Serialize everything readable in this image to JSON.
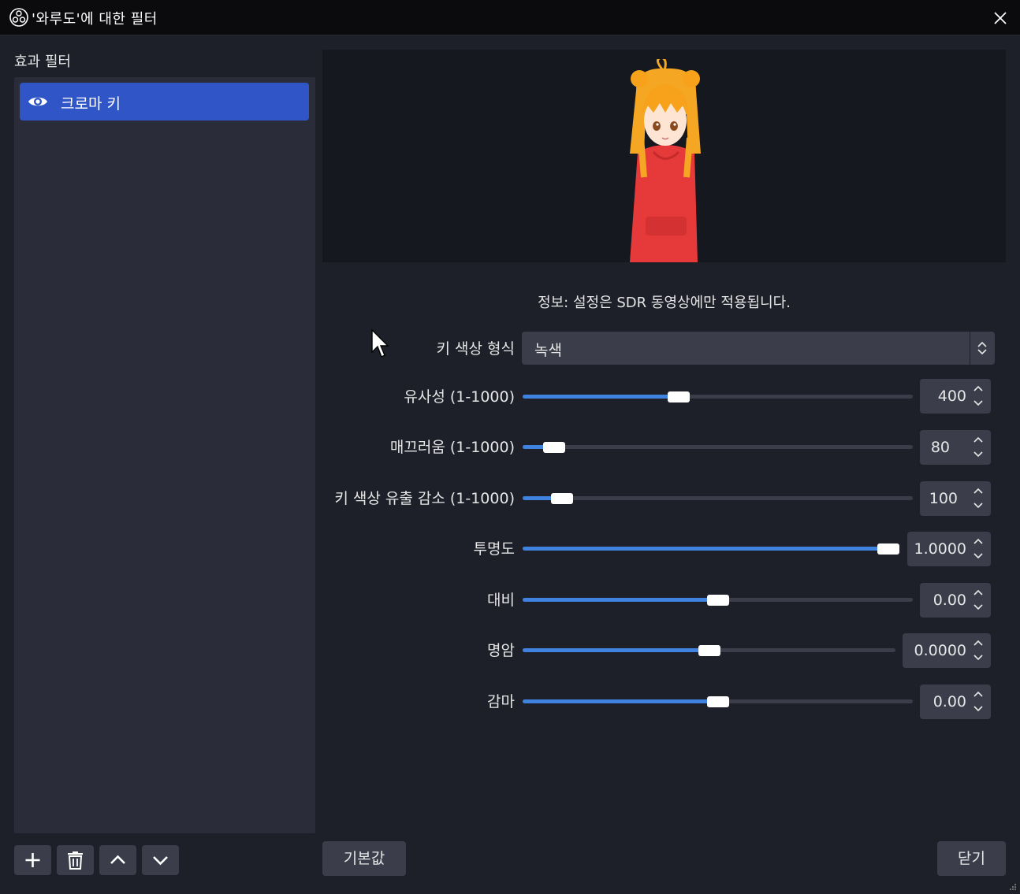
{
  "window": {
    "title": "'와루도'에 대한 필터",
    "app_icon": "obs-logo-icon",
    "close_icon": "close-icon"
  },
  "filters": {
    "section_label": "효과 필터",
    "items": [
      {
        "label": "크로마 키",
        "icon": "eye-icon",
        "selected": true
      }
    ],
    "toolbar": [
      "add-icon",
      "trash-icon",
      "chevron-up-icon",
      "chevron-down-icon"
    ]
  },
  "info_text": "정보: 설정은 SDR 동영상에만 적용됩니다.",
  "settings": {
    "key_color_type": {
      "label": "키 색상 형식",
      "value": "녹색"
    },
    "similarity": {
      "label": "유사성 (1-1000)",
      "value": "400",
      "level": 0.4
    },
    "smoothness": {
      "label": "매끄러움 (1-1000)",
      "value": "80",
      "level": 0.08
    },
    "spill": {
      "label": "키 색상 유출 감소 (1-1000)",
      "value": "100",
      "level": 0.1
    },
    "opacity": {
      "label": "투명도",
      "value": "1.0000",
      "level": 1.0
    },
    "contrast": {
      "label": "대비",
      "value": "0.00",
      "level": 0.5
    },
    "brightness": {
      "label": "명암",
      "value": "0.0000",
      "level": 0.5
    },
    "gamma": {
      "label": "감마",
      "value": "0.00",
      "level": 0.5
    }
  },
  "buttons": {
    "defaults": "기본값",
    "close": "닫기"
  },
  "colors": {
    "accent": "#2f55c6",
    "slider_fill": "#3f82e0",
    "panel": "#2a2d39",
    "background": "#1e2029"
  }
}
